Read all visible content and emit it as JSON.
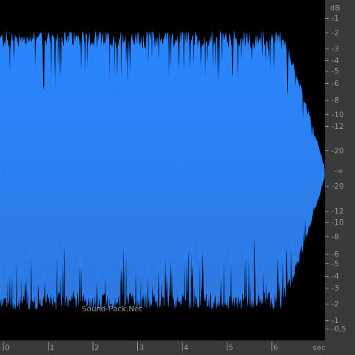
{
  "watermark": "Sound-Pack.Net",
  "colors": {
    "background": "#000000",
    "panel": "#3a3a3a",
    "waveform_top": "#2a86ff",
    "waveform_bottom": "#2f78e0",
    "axis_text": "#9a9a9a"
  },
  "db_axis": {
    "unit_label": "dB",
    "top_labels": [
      "-1",
      "-2",
      "-3",
      "-4",
      "-5",
      "-6",
      "-8",
      "-10",
      "-12",
      "-20"
    ],
    "center_label": "-∞",
    "bottom_labels": [
      "-20",
      "-12",
      "-10",
      "-8",
      "-6",
      "-5",
      "-4",
      "-3",
      "-2",
      "-1",
      "-0,5"
    ]
  },
  "time_axis": {
    "unit_label": "sec",
    "labels": [
      "0",
      "1",
      "2",
      "3",
      "4",
      "5",
      "6"
    ],
    "duration_sec": 7.15
  }
}
